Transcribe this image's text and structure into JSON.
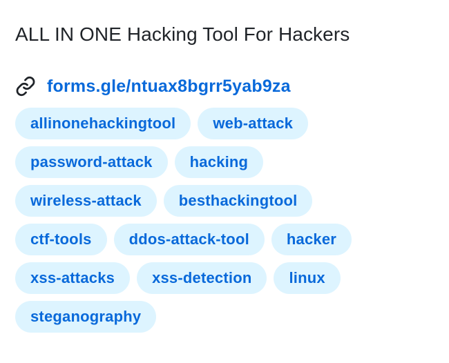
{
  "about": {
    "description": "ALL IN ONE Hacking Tool For Hackers",
    "homepage": {
      "icon": "link-icon",
      "label": "forms.gle/ntuax8bgrr5yab9za"
    },
    "topics": [
      "allinonehackingtool",
      "web-attack",
      "password-attack",
      "hacking",
      "wireless-attack",
      "besthackingtool",
      "ctf-tools",
      "ddos-attack-tool",
      "hacker",
      "xss-attacks",
      "xss-detection",
      "linux",
      "steganography"
    ]
  },
  "colors": {
    "accent": "#0969da",
    "topic_background": "#ddf4ff",
    "text": "#1f2328"
  }
}
